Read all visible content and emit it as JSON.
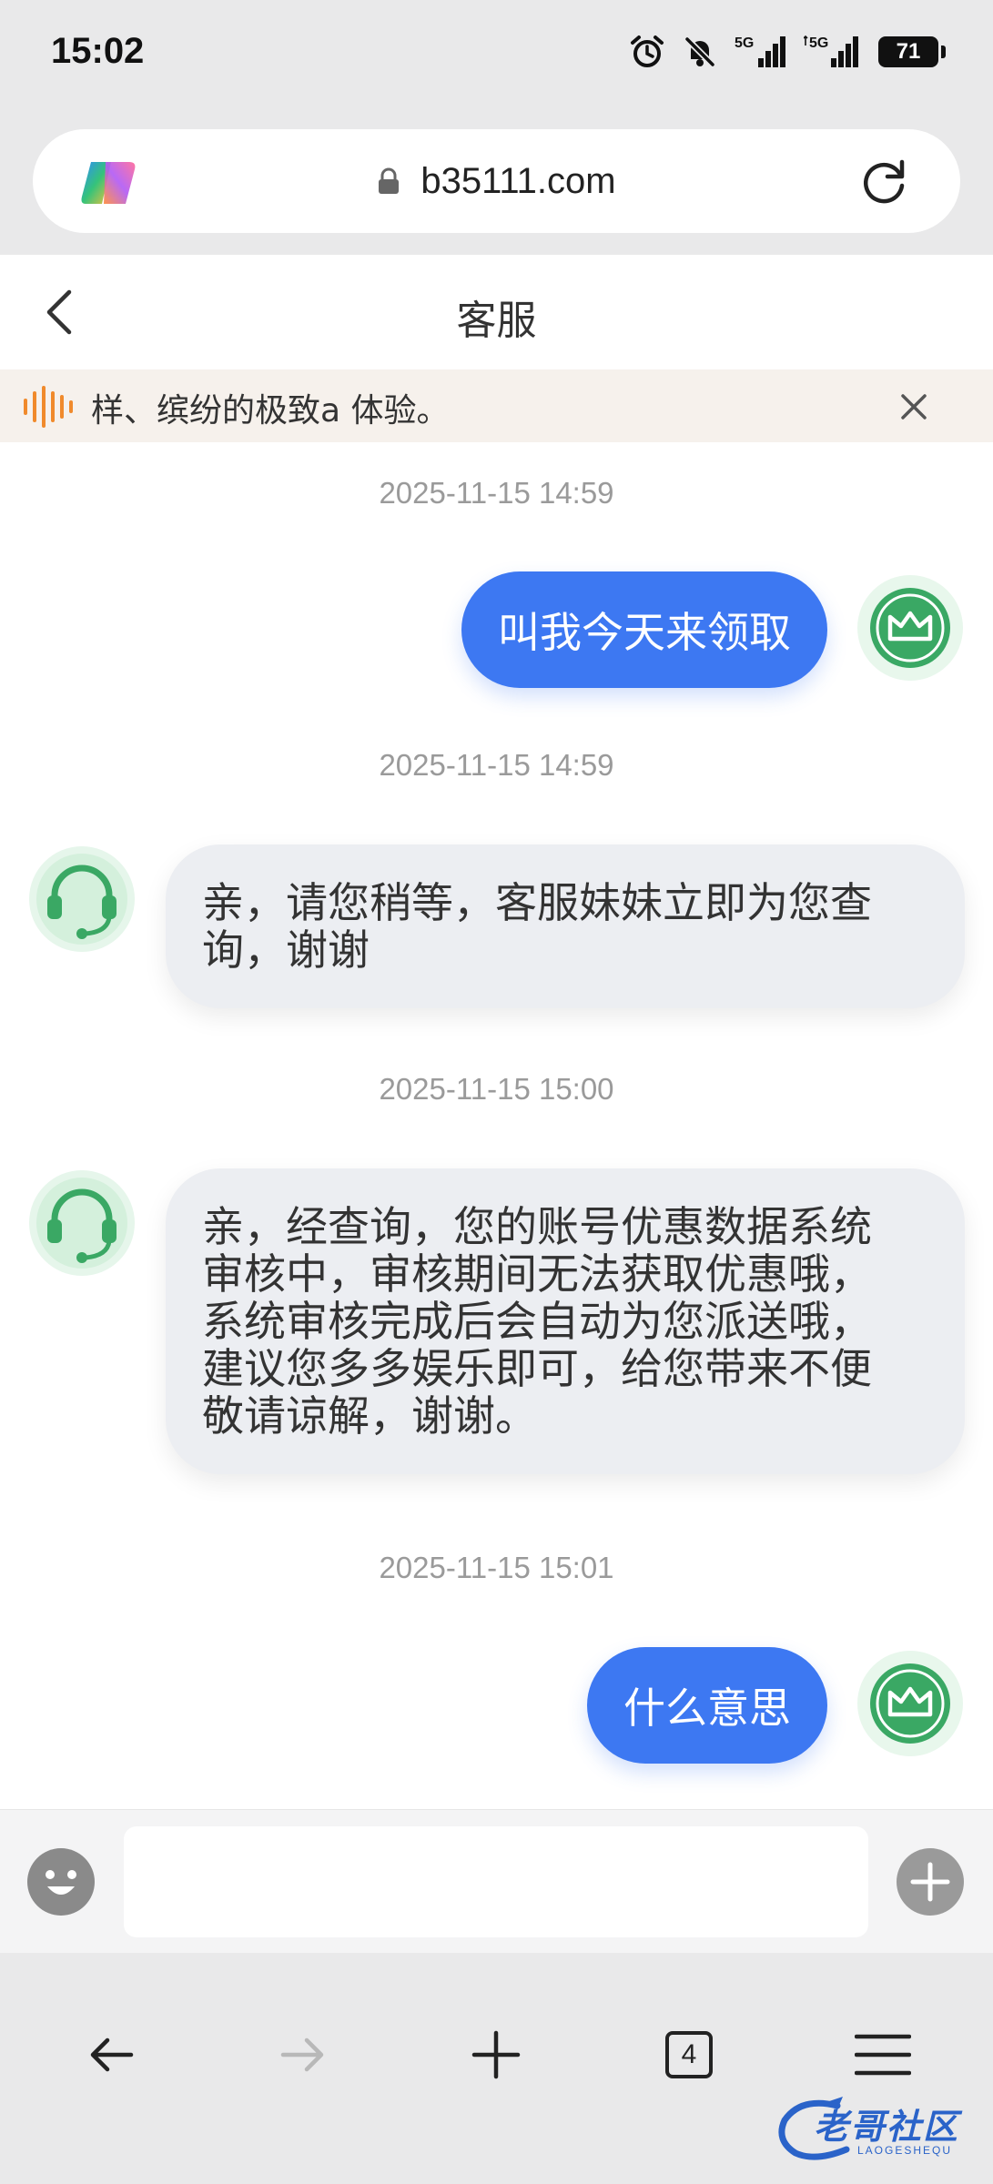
{
  "status_bar": {
    "time": "15:02",
    "battery": "71"
  },
  "browser": {
    "url": "b35111.com",
    "tab_count": "4"
  },
  "page": {
    "title": "客服",
    "notice": "样、缤纷的极致a 体验。"
  },
  "messages": [
    {
      "timestamp": "2025-11-15 14:59",
      "direction": "outgoing",
      "text": "叫我今天来领取"
    },
    {
      "timestamp": "2025-11-15 14:59",
      "direction": "incoming",
      "lines": [
        "亲，请您稍等，客服妹妹立即为您查",
        "询，谢谢"
      ]
    },
    {
      "timestamp": "2025-11-15 15:00",
      "direction": "incoming",
      "lines": [
        "亲，经查询，您的账号优惠数据系统",
        "审核中，审核期间无法获取优惠哦，",
        "系统审核完成后会自动为您派送哦，",
        "建议您多多娱乐即可，给您带来不便",
        "敬请谅解，谢谢。"
      ]
    },
    {
      "timestamp": "2025-11-15 15:01",
      "direction": "outgoing",
      "text": "什么意思"
    }
  ],
  "input": {
    "value": "",
    "placeholder": ""
  },
  "watermark": {
    "text": "老哥社区",
    "sub": "LAOGESHEQU"
  },
  "icons": [
    "copilot-logo-icon",
    "lock-icon",
    "reload-icon",
    "chevron-left-icon",
    "sound-wave-icon",
    "close-icon",
    "crown-avatar-icon",
    "headset-avatar-icon",
    "emoji-icon",
    "plus-circle-icon",
    "arrow-left-icon",
    "arrow-right-icon",
    "plus-icon",
    "tabs-icon",
    "menu-icon",
    "alarm-icon",
    "mute-bell-icon",
    "signal-5g-icon"
  ],
  "colors": {
    "accent_blue": "#3d78f2",
    "incoming_bubble": "#eceef2",
    "avatar_green": "#3aa864",
    "notice_bg": "#f6f1ec",
    "notice_icon": "#f08a2c"
  }
}
